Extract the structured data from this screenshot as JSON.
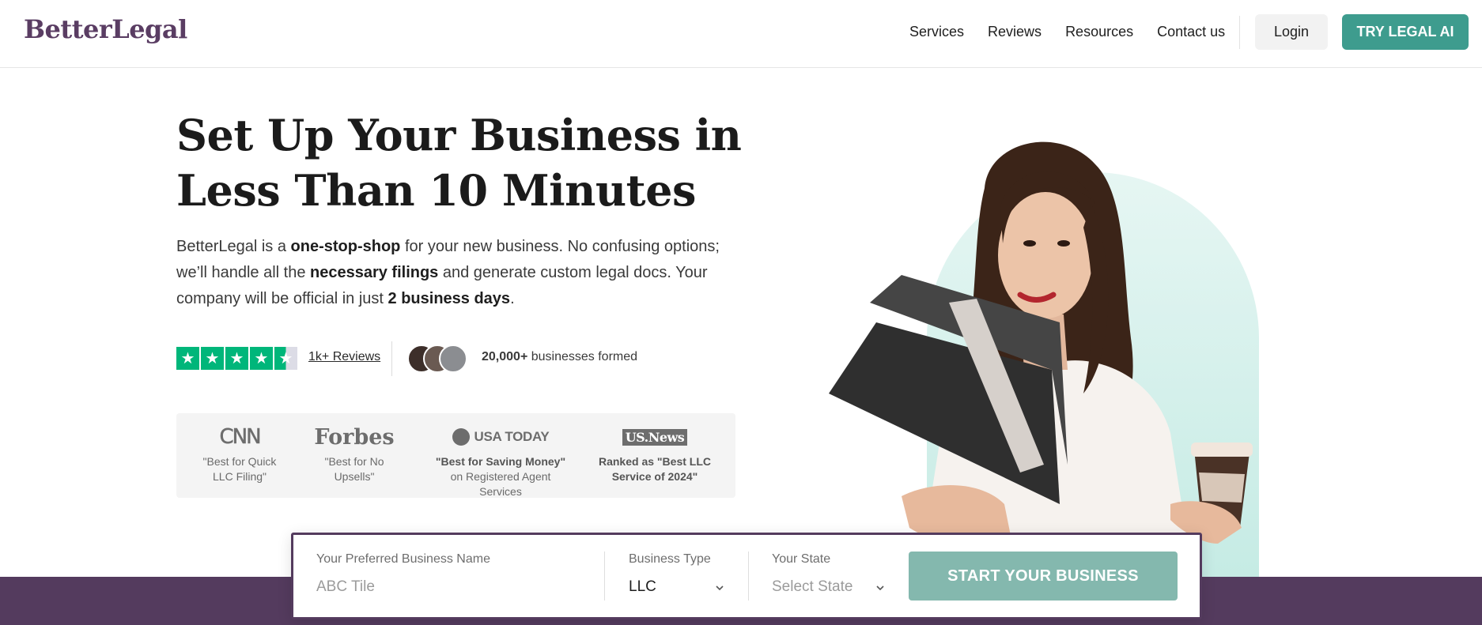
{
  "header": {
    "logo": "BetterLegal",
    "nav": [
      "Services",
      "Reviews",
      "Resources",
      "Contact us"
    ],
    "login": "Login",
    "cta": "TRY LEGAL AI"
  },
  "hero": {
    "title_line1": "Set Up Your Business in",
    "title_line2": "Less Than 10 Minutes",
    "desc_parts": [
      "BetterLegal is a ",
      "one-stop-shop",
      " for your new business. No confusing options; we’ll handle all the ",
      "necessary filings",
      " and generate custom legal docs. Your company will be official in just ",
      "2 business days",
      "."
    ]
  },
  "social": {
    "rating_stars": 4.5,
    "reviews_link": "1k+ Reviews",
    "businesses_count": "20,000+",
    "businesses_suffix": " businesses formed"
  },
  "press": [
    {
      "logo": "CNN",
      "quote": "\"Best for Quick LLC Filing\"",
      "suffix": ""
    },
    {
      "logo": "Forbes",
      "quote": "\"Best for No Upsells\"",
      "suffix": ""
    },
    {
      "logo": "USA TODAY",
      "quote": "\"Best for Saving Money\"",
      "suffix": " on Registered Agent Services"
    },
    {
      "logo": "US.News",
      "quote": "Ranked as \"Best LLC Service of 2024\"",
      "suffix": ""
    }
  ],
  "form": {
    "name_label": "Your Preferred Business Name",
    "name_placeholder": "ABC Tile",
    "type_label": "Business Type",
    "type_value": "LLC",
    "state_label": "Your State",
    "state_placeholder": "Select State",
    "submit": "START YOUR BUSINESS"
  },
  "colors": {
    "brand_purple": "#543b5e",
    "teal": "#3e9c8e",
    "teal_light": "#84b8ae",
    "trustpilot_green": "#00b67a"
  }
}
